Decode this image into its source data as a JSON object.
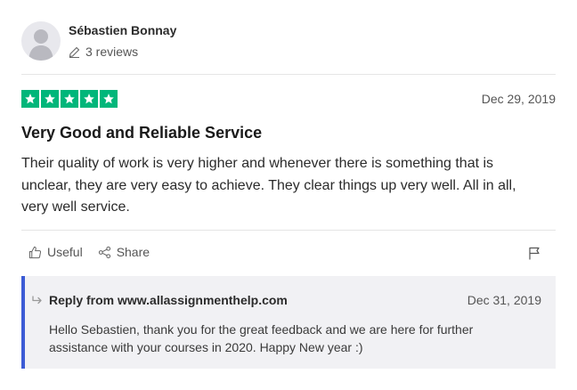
{
  "author": {
    "name": "Sébastien Bonnay",
    "review_count": "3 reviews"
  },
  "review": {
    "rating": 5,
    "date": "Dec 29, 2019",
    "title": "Very Good and Reliable Service",
    "body": "Their quality of work is very higher and whenever there is something that is unclear, they are very easy to achieve. They clear things up very well. All in all, very well service."
  },
  "actions": {
    "useful_label": "Useful",
    "share_label": "Share"
  },
  "reply": {
    "heading": "Reply from www.allassignmenthelp.com",
    "date": "Dec 31, 2019",
    "body": "Hello Sebastien, thank you for the great feedback and we are here for further assistance with your courses in 2020. Happy New year :)"
  },
  "colors": {
    "star_green": "#00b67a",
    "reply_accent": "#3c5bd5",
    "reply_bg": "#f1f1f4"
  },
  "icons": [
    "avatar-placeholder-icon",
    "pencil-icon",
    "star-icon",
    "thumbs-up-icon",
    "share-icon",
    "flag-icon",
    "reply-arrow-icon"
  ]
}
